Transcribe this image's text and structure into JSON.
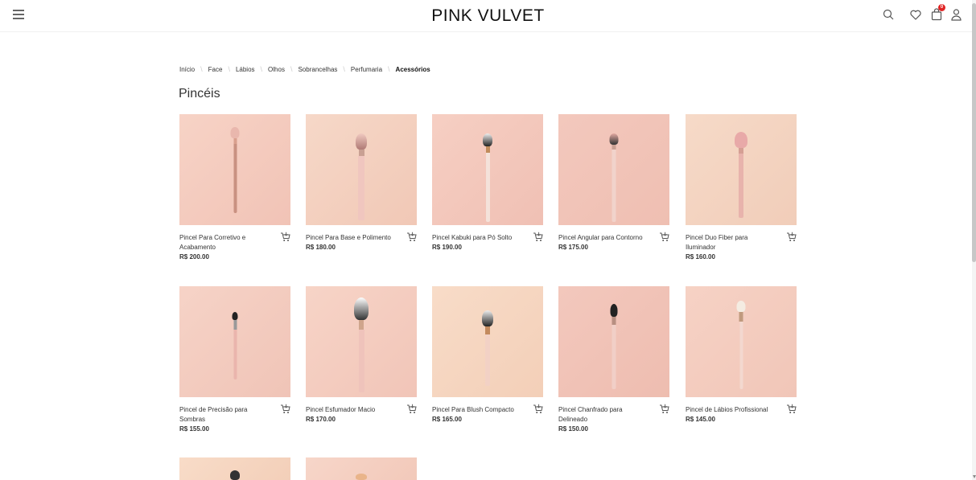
{
  "header": {
    "logo": "PINK VULVET",
    "cart_count": "0",
    "icons": [
      "menu-icon",
      "search-icon",
      "heart-icon",
      "shopping-bag-icon",
      "user-icon"
    ]
  },
  "breadcrumb": [
    "Início",
    "Face",
    "Lábios",
    "Olhos",
    "Sobrancelhas",
    "Perfumaria",
    "Acessórios"
  ],
  "page_title": "Pincéis",
  "products": [
    {
      "name": "Pincel Para Corretivo e Acabamento",
      "price": "R$ 200.00"
    },
    {
      "name": "Pincel Para Base e Polimento",
      "price": "R$ 180.00"
    },
    {
      "name": "Pincel Kabuki para Pó Solto",
      "price": "R$ 190.00"
    },
    {
      "name": "Pincel Angular para Contorno",
      "price": "R$ 175.00"
    },
    {
      "name": "Pincel Duo Fiber para Iluminador",
      "price": "R$ 160.00"
    },
    {
      "name": "Pincel de Precisão para Sombras",
      "price": "R$ 155.00"
    },
    {
      "name": "Pincel Esfumador Macio",
      "price": "R$ 170.00"
    },
    {
      "name": "Pincel Para Blush Compacto",
      "price": "R$ 165.00"
    },
    {
      "name": "Pincel Chanfrado para Delineado",
      "price": "R$ 150.00"
    },
    {
      "name": "Pincel de Lábios Profissional",
      "price": "R$ 145.00"
    }
  ],
  "colors": {
    "badge": "#e02424",
    "tile_peach": "#f6d7c8",
    "tile_pink": "#f3c6bc"
  }
}
